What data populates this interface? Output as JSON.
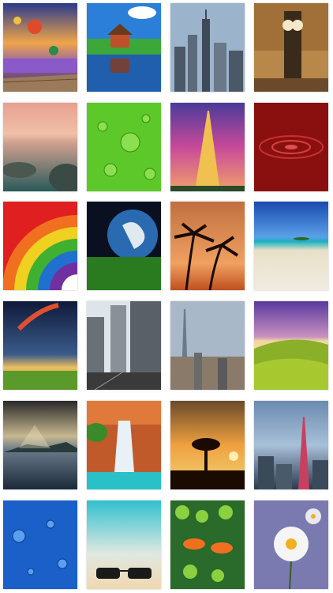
{
  "gallery": {
    "tiles": [
      {
        "name": "balloons",
        "icon": "hot-air-balloon-icon"
      },
      {
        "name": "cottage-reflection",
        "icon": "house-icon"
      },
      {
        "name": "city-skyline",
        "icon": "city-icon"
      },
      {
        "name": "street-clock",
        "icon": "clock-icon"
      },
      {
        "name": "seaside-sunset",
        "icon": "sunset-icon"
      },
      {
        "name": "green-water-drops",
        "icon": "drop-icon"
      },
      {
        "name": "eiffel-tower",
        "icon": "tower-icon"
      },
      {
        "name": "red-water-ripple",
        "icon": "ripple-icon"
      },
      {
        "name": "rainbow-arcs",
        "icon": "rainbow-icon"
      },
      {
        "name": "earth-from-space",
        "icon": "globe-icon"
      },
      {
        "name": "palm-sunset",
        "icon": "palm-icon"
      },
      {
        "name": "tropical-beach",
        "icon": "beach-icon"
      },
      {
        "name": "planet-sky",
        "icon": "planet-icon"
      },
      {
        "name": "city-street",
        "icon": "building-icon"
      },
      {
        "name": "dubai-skyline",
        "icon": "skyscraper-icon"
      },
      {
        "name": "green-hills",
        "icon": "hill-icon"
      },
      {
        "name": "sunrays-ocean",
        "icon": "sun-icon"
      },
      {
        "name": "waterfall",
        "icon": "waterfall-icon"
      },
      {
        "name": "lone-tree-sunset",
        "icon": "tree-icon"
      },
      {
        "name": "empire-state",
        "icon": "tower-icon"
      },
      {
        "name": "blue-water-drops",
        "icon": "drop-icon"
      },
      {
        "name": "sunglasses-beach",
        "icon": "sunglasses-icon"
      },
      {
        "name": "clownfish",
        "icon": "fish-icon"
      },
      {
        "name": "daisy",
        "icon": "flower-icon"
      }
    ]
  }
}
